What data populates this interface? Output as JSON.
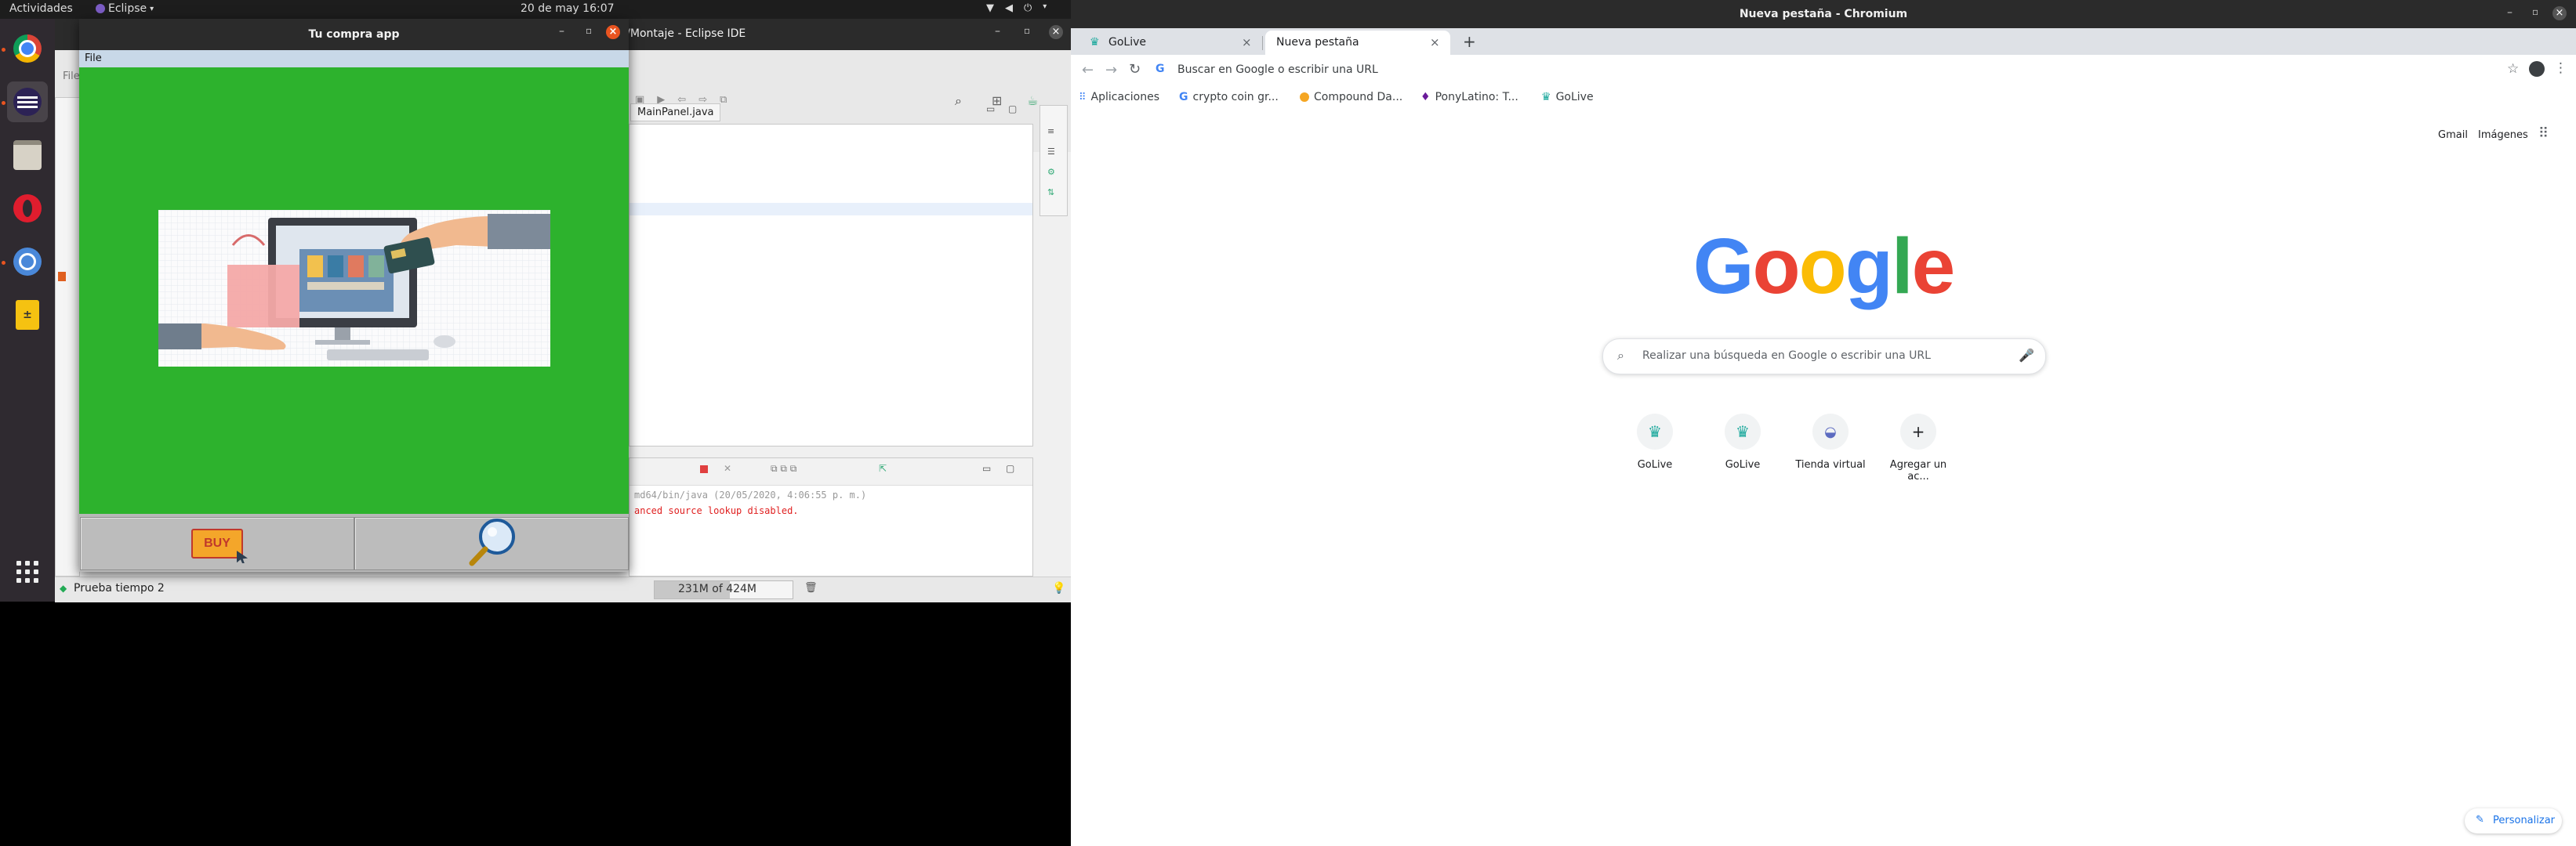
{
  "topbar": {
    "activities": "Actividades",
    "app_menu": "Eclipse",
    "clock": "20 de may  16:07"
  },
  "dock": {
    "items": [
      "chrome-icon",
      "eclipse-icon",
      "files-icon",
      "opera-icon",
      "chromium-icon",
      "calculator-icon",
      "show-apps-icon"
    ]
  },
  "eclipse": {
    "title": "v_2/Montaje - Eclipse IDE",
    "menu_fragment": "File",
    "editor_tab": "MainPanel.java",
    "console_header": "md64/bin/java (20/05/2020, 4:06:55 p. m.)",
    "console_line": "anced source lookup disabled.",
    "status_left": "Prueba tiempo 2",
    "memory": "231M of 424M"
  },
  "javaapp": {
    "title": "Tu compra app",
    "menu": "File",
    "buy_label": "BUY",
    "colors": {
      "green": "#2db22d"
    }
  },
  "chromium": {
    "window_title": "Nueva pestaña - Chromium",
    "tabs": [
      {
        "label": "GoLive"
      },
      {
        "label": "Nueva pestaña"
      }
    ],
    "omnibox_placeholder": "Buscar en Google o escribir una URL",
    "bookmarks": [
      "Aplicaciones",
      "crypto coin gr...",
      "Compound Da...",
      "PonyLatino: T...",
      "GoLive"
    ],
    "top_links": [
      "Gmail",
      "Imágenes"
    ],
    "search_placeholder": "Realizar una búsqueda en Google o escribir una URL",
    "shortcuts": [
      "GoLive",
      "GoLive",
      "Tienda virtual",
      "Agregar un ac..."
    ],
    "customize": "Personalizar"
  }
}
